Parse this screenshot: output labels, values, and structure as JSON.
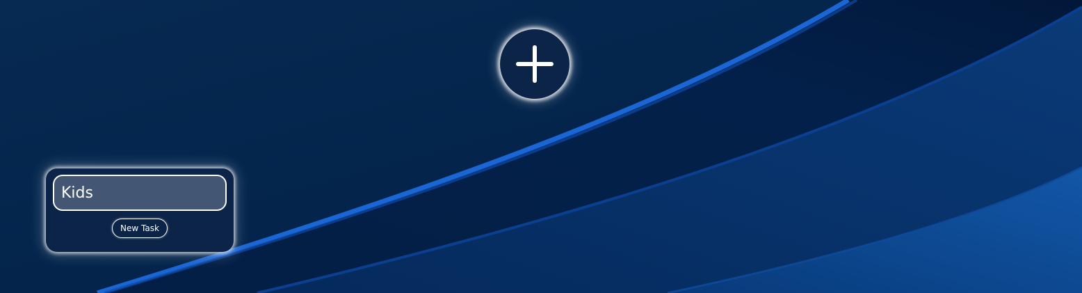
{
  "app": {
    "add_list_icon": "plus-icon"
  },
  "list_card": {
    "title_value": "Kids",
    "new_task_label": "New Task"
  },
  "colors": {
    "background_dark": "#042650",
    "wave_highlight": "#1a66d4",
    "card_background": "#0b2448",
    "input_background": "#435674",
    "text": "#ffffff"
  }
}
